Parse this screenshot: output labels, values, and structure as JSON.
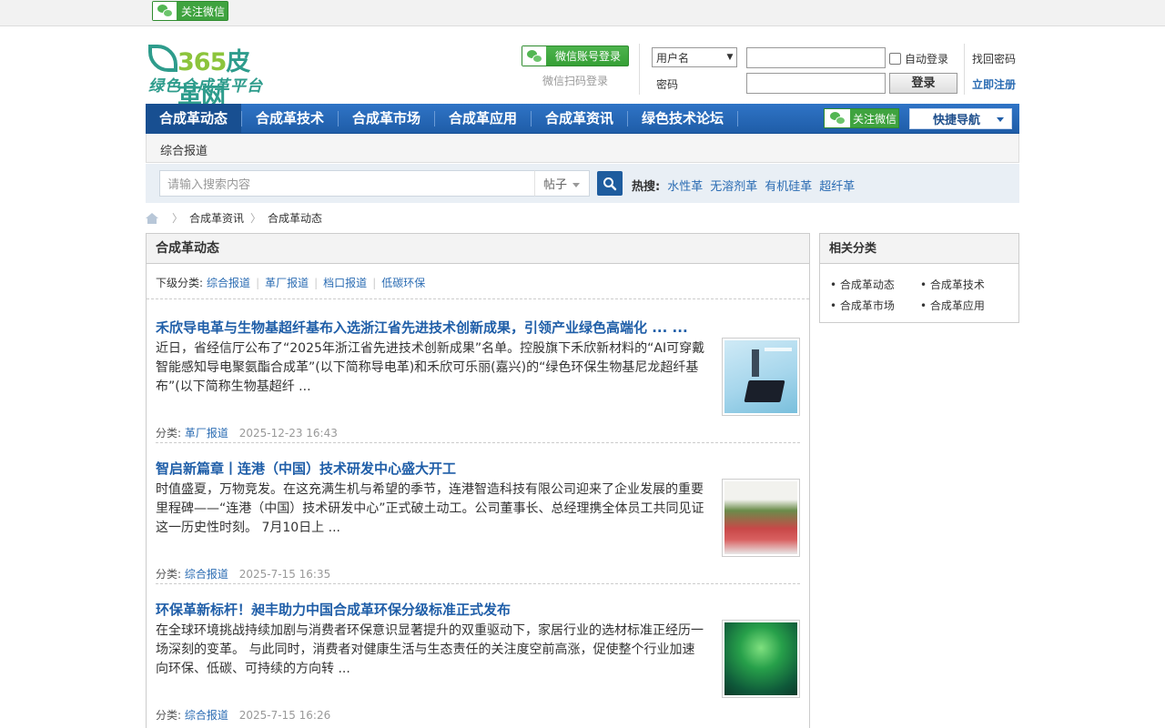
{
  "topbar": {
    "follow_wechat": "关注微信"
  },
  "logo": {
    "brand_num": "365",
    "brand_name": "皮革网",
    "slogan": "绿色合成革平台"
  },
  "login": {
    "wechat_login": "微信账号登录",
    "wechat_scan": "微信扫码登录",
    "user_type_selected": "用户名",
    "password_label": "密码",
    "auto_login": "自动登录",
    "login_button": "登录",
    "find_password": "找回密码",
    "register": "立即注册"
  },
  "nav": {
    "items": [
      "合成革动态",
      "合成革技术",
      "合成革市场",
      "合成革应用",
      "合成革资讯",
      "绿色技术论坛"
    ],
    "follow_wechat": "关注微信",
    "quick_nav": "快捷导航"
  },
  "subnav": {
    "item": "综合报道"
  },
  "search": {
    "placeholder": "请输入搜索内容",
    "type": "帖子",
    "hot_label": "热搜:",
    "hot_terms": [
      "水性革",
      "无溶剂革",
      "有机硅革",
      "超纤革"
    ]
  },
  "breadcrumb": {
    "items": [
      "合成革资讯",
      "合成革动态"
    ]
  },
  "main": {
    "title": "合成革动态",
    "subcats_label": "下级分类:",
    "subcats": [
      "综合报道",
      "革厂报道",
      "档口报道",
      "低碳环保"
    ],
    "posts": [
      {
        "title": "禾欣导电革与生物基超纤基布入选浙江省先进技术创新成果，引领产业绿色高端化 ... ...",
        "summary": "近日，省经信厅公布了“2025年浙江省先进技术创新成果”名单。控股旗下禾欣新材料的“AI可穿戴智能感知导电聚氨酯合成革”(以下简称导电革)和禾欣可乐丽(嘉兴)的“绿色环保生物基尼龙超纤基布”(以下简称生物基超纤 ...",
        "category_label": "分类:",
        "category": "革厂报道",
        "date": "2025-12-23 16:43"
      },
      {
        "title": "智启新篇章丨连港（中国）技术研发中心盛大开工",
        "summary": "时值盛夏，万物竞发。在这充满生机与希望的季节，连港智造科技有限公司迎来了企业发展的重要里程碑——“连港（中国）技术研发中心”正式破土动工。公司董事长、总经理携全体员工共同见证这一历史性时刻。 7月10日上 ...",
        "category_label": "分类:",
        "category": "综合报道",
        "date": "2025-7-15 16:35"
      },
      {
        "title": "环保革新标杆！昶丰助力中国合成革环保分级标准正式发布",
        "summary": "在全球环境挑战持续加剧与消费者环保意识显著提升的双重驱动下，家居行业的选材标准正经历一场深刻的变革。 与此同时，消费者对健康生活与生态责任的关注度空前高涨，促使整个行业加速向环保、低碳、可持续的方向转 ...",
        "category_label": "分类:",
        "category": "综合报道",
        "date": "2025-7-15 16:26"
      }
    ]
  },
  "sidebar": {
    "title": "相关分类",
    "cats": [
      "合成革动态",
      "合成革技术",
      "合成革市场",
      "合成革应用"
    ]
  }
}
